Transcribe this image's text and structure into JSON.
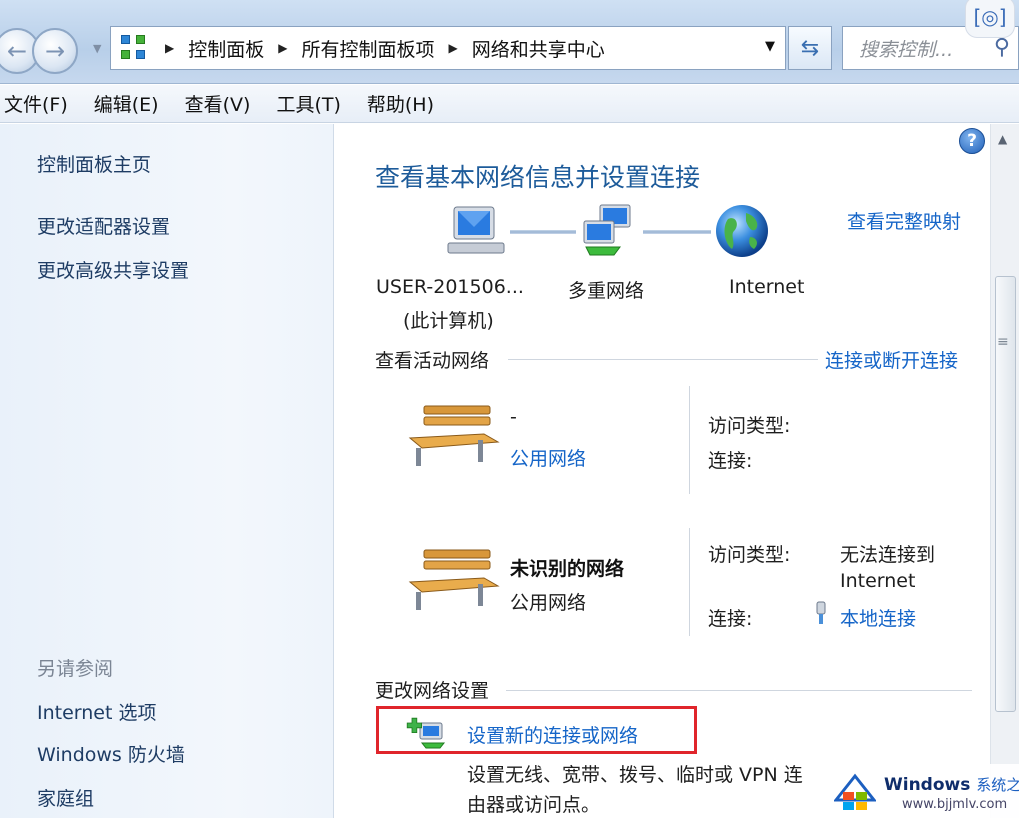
{
  "address_bar": {
    "crumbs": [
      "控制面板",
      "所有控制面板项",
      "网络和共享中心"
    ],
    "search_placeholder": "搜索控制..."
  },
  "menu": [
    "文件(F)",
    "编辑(E)",
    "查看(V)",
    "工具(T)",
    "帮助(H)"
  ],
  "left_pane": {
    "home": "控制面板主页",
    "links": [
      "更改适配器设置",
      "更改高级共享设置"
    ],
    "see_also_title": "另请参阅",
    "see_also": [
      "Internet 选项",
      "Windows 防火墙",
      "家庭组"
    ]
  },
  "main": {
    "heading": "查看基本网络信息并设置连接",
    "full_map_link": "查看完整映射",
    "nodes": {
      "computer_name": "USER-201506...",
      "computer_sub": "(此计算机)",
      "multi": "多重网络",
      "internet": "Internet"
    },
    "active_section_title": "查看活动网络",
    "connect_link": "连接或断开连接",
    "networks": [
      {
        "name": "-",
        "type": "公用网络",
        "access_label": "访问类型:",
        "access_value": "",
        "conn_label": "连接:",
        "conn_value": ""
      },
      {
        "name": "未识别的网络",
        "type": "公用网络",
        "access_label": "访问类型:",
        "access_value_1": "无法连接到",
        "access_value_2": "Internet",
        "conn_label": "连接:",
        "conn_value": "本地连接"
      }
    ],
    "change_section_title": "更改网络设置",
    "new_connection_link": "设置新的连接或网络",
    "new_connection_desc_1": "设置无线、宽带、拨号、临时或 VPN 连",
    "new_connection_desc_2": "由器或访问点。"
  },
  "watermark": {
    "brand": "Windows",
    "brand_cn": "系统之家",
    "url": "www.bjjmlv.com"
  },
  "colors": {
    "link": "#1565c8",
    "heading": "#1d5b9a",
    "highlight_box": "#e0252b"
  }
}
